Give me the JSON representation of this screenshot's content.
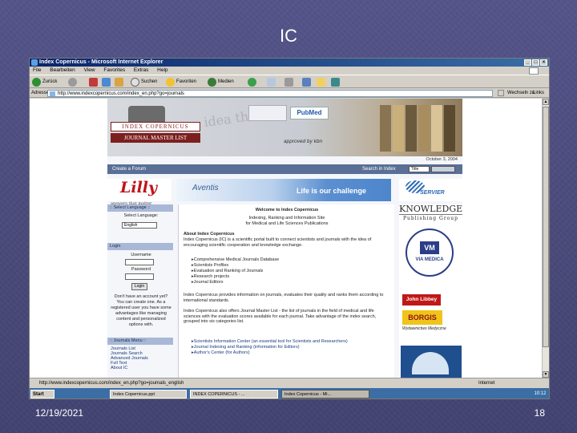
{
  "slide": {
    "title": "IC",
    "date": "12/19/2021",
    "page_number": "18"
  },
  "browser": {
    "window_title": "Index Copernicus - Microsoft Internet Explorer",
    "menu": [
      "File",
      "Bearbeiten",
      "View",
      "Favorites",
      "Extras",
      "Help"
    ],
    "toolbar": {
      "back": "Zurück",
      "search": "Suchen",
      "favorites": "Favoriten",
      "media": "Medien"
    },
    "address_label": "Adresse",
    "address_value": "http://www.indexcopernicus.com/index_en.php?go=journals",
    "go_label": "Wechseln zu",
    "links_label": "Links",
    "status_text": "http://www.indexcopernicus.com/index_en.php?go=journals_english",
    "status_zone": "Internet",
    "taskbar": {
      "start": "Start",
      "tasks": [
        "Index Copernicus.ppt",
        "INDEX COPERNICUS - ...",
        "Index Copernicus - Mi..."
      ],
      "clock": "10:12"
    }
  },
  "page": {
    "logo_line1": "INDEX COPERNICUS",
    "logo_line2": "JOURNAL MASTER LIST",
    "watermark": "idea thinks",
    "pubmed": "PubMed",
    "approved_by": "approved by kbn",
    "date_line": "October 3, 2004",
    "nav_left": "Create a Forum",
    "nav_search": "Search in Index",
    "nav_select": "Title",
    "ads": {
      "lilly": "Lilly",
      "lilly_tag": "answers that matter",
      "aventis": "Aventis",
      "aventis_slogan": "Life is our challenge",
      "servier": "SERVIER",
      "knowledge": "KNOWLEDGE",
      "knowledge_sub": "Publishing Group",
      "via_medica": "VIA MEDICA",
      "john_libbey": "John Libbey",
      "borgis": "BORGIS",
      "borgis_sub": "Wydawnictwo Medyczne"
    },
    "left": {
      "lang_header": ":: Select Language ::",
      "lang_label": "Select Language:",
      "lang_value": "English",
      "login_header": "Login",
      "login_user": "Username",
      "login_pass": "Password",
      "login_button": "Login",
      "register_text": "Don't have an account yet? You can create one. As a registered user you have some advantages like managing content and personalized options with.",
      "journals_header": ":: Journals Menu ::",
      "journals_items": [
        "Journals List",
        "Journals Search",
        "Advanced Journals",
        "Full Text",
        "About IC"
      ]
    },
    "center": {
      "welcome": "Welcome to Index Copernicus",
      "subtitle_1": "Indexing, Ranking and Information Site",
      "subtitle_2": "for Medical and Life Sciences Publications",
      "about_heading": "About Index Copernicus",
      "about_text": "Index Copernicus (IC) is a scientific portal built to connect scientists and journals with the idea of encouraging scientific cooperation and knowledge exchange.",
      "bullets": [
        "Comprehensive Medical Journals Database",
        "Scientists Profiles",
        "Evaluation and Ranking of Journals",
        "Research projects",
        "Journal Editors"
      ],
      "para_2": "Index Copernicus provides information on journals, evaluates their quality and ranks them according to international standards.",
      "para_3": "Index Copernicus also offers Journal Master List - the list of journals in the field of medical and life sciences with the evaluation scores available for each journal. Take advantage of the index search, grouped into six categories list.",
      "links": [
        "Scientists Information Center (an essential tool for Scientists and Researchers)",
        "Journal Indexing and Ranking (information for Editors)",
        "Author's Center (for Authors)"
      ]
    }
  }
}
